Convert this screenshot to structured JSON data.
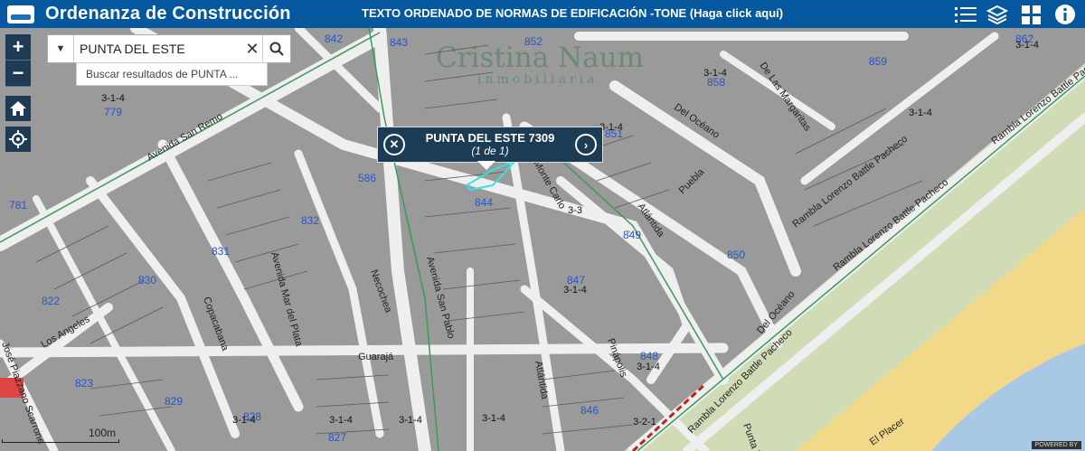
{
  "header": {
    "app_title": "Ordenanza de Construcción",
    "link_title": "TEXTO ORDENADO DE NORMAS DE EDIFICACIÓN -TONE (Haga click aquí)"
  },
  "search": {
    "value": "PUNTA DEL ESTE",
    "suggestion": "Buscar resultados de PUNTA ..."
  },
  "popup": {
    "title": "PUNTA DEL ESTE 7309",
    "count": "(1 de 1)"
  },
  "zoom": {
    "in": "+",
    "out": "−"
  },
  "scale_label": "100m",
  "powered_by": "POWERED BY",
  "watermark": {
    "name": "Cristina Naum",
    "sub": "inmobiliaria"
  },
  "block_numbers": [
    "842",
    "843",
    "852",
    "862",
    "859",
    "858",
    "851",
    "779",
    "586",
    "781",
    "832",
    "831",
    "830",
    "822",
    "844",
    "849",
    "850",
    "847",
    "823",
    "829",
    "828",
    "827",
    "846",
    "848"
  ],
  "zone_labels": [
    "3-1-4",
    "3-1-4",
    "3-1-4",
    "3-1-4",
    "3-1-4",
    "3-1-4",
    "3-1-4",
    "3-1-4",
    "3-1-4",
    "3-1-4",
    "3-3",
    "3-2-1",
    "3-1-4"
  ],
  "streets": [
    "Avenida San Remo",
    "Del Océano",
    "De Las Margaritas",
    "Puebla",
    "Atlántida",
    "Monte Carlo",
    "Avenida Mar del Plata",
    "Copacabana",
    "Necochea",
    "Avenida San Pablo",
    "Los Angeles",
    "José Piazzano Scarrone",
    "Guarajá",
    "Atlántida",
    "Pinápolis",
    "Del Océano",
    "Rambla Lorenzo Battle Pacheco",
    "Rambla Lorenzo Battle Pacheco",
    "Rambla Lorenzo Battle Pacheco",
    "Rambla Lorenzo Battle Pacheco",
    "El Placer",
    "Punta D"
  ],
  "colors": {
    "header": "#05579e",
    "block": "#9a9a9a",
    "road": "#efefef",
    "beach": "#f2d98a",
    "park": "#cfdcb5",
    "water": "#a9c8e6",
    "label": "#2a55c8"
  }
}
